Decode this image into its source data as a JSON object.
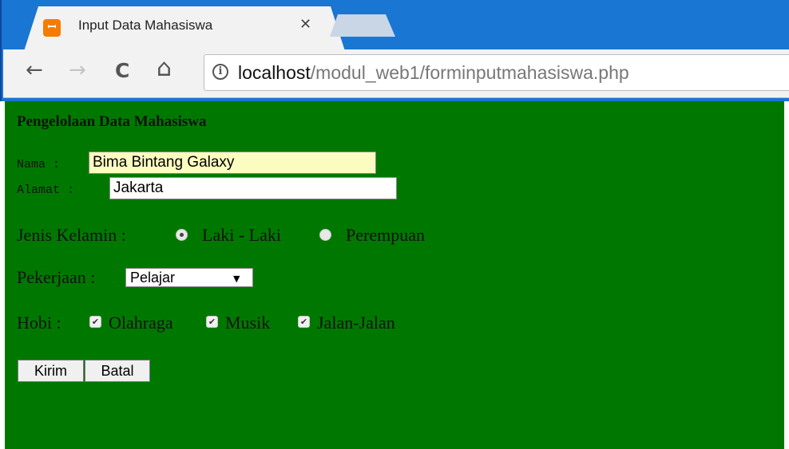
{
  "browser": {
    "tab": {
      "title": "Input Data Mahasiswa",
      "favicon": "xampp-icon",
      "close_glyph": "✕"
    },
    "nav": {
      "back": "←",
      "forward": "→",
      "reload": "C",
      "home": "⌂"
    },
    "address": {
      "host": "localhost",
      "path": "/modul_web1/forminputmahasiswa.php"
    },
    "accent_color": "#1976d2"
  },
  "page": {
    "background": "#007800",
    "heading": "Pengelolaan Data Mahasiswa",
    "nama": {
      "label": "Nama :",
      "value": "Bima Bintang Galaxy"
    },
    "alamat": {
      "label": "Alamat :",
      "value": "Jakarta"
    },
    "jenis_kelamin": {
      "label": "Jenis Kelamin :",
      "options": [
        {
          "label": "Laki - Laki",
          "checked": true
        },
        {
          "label": "Perempuan",
          "checked": false
        }
      ]
    },
    "pekerjaan": {
      "label": "Pekerjaan :",
      "selected": "Pelajar"
    },
    "hobi": {
      "label": "Hobi :",
      "options": [
        {
          "label": "Olahraga",
          "checked": true
        },
        {
          "label": "Musik",
          "checked": true
        },
        {
          "label": "Jalan-Jalan",
          "checked": true
        }
      ]
    },
    "buttons": {
      "submit": "Kirim",
      "reset": "Batal"
    }
  }
}
